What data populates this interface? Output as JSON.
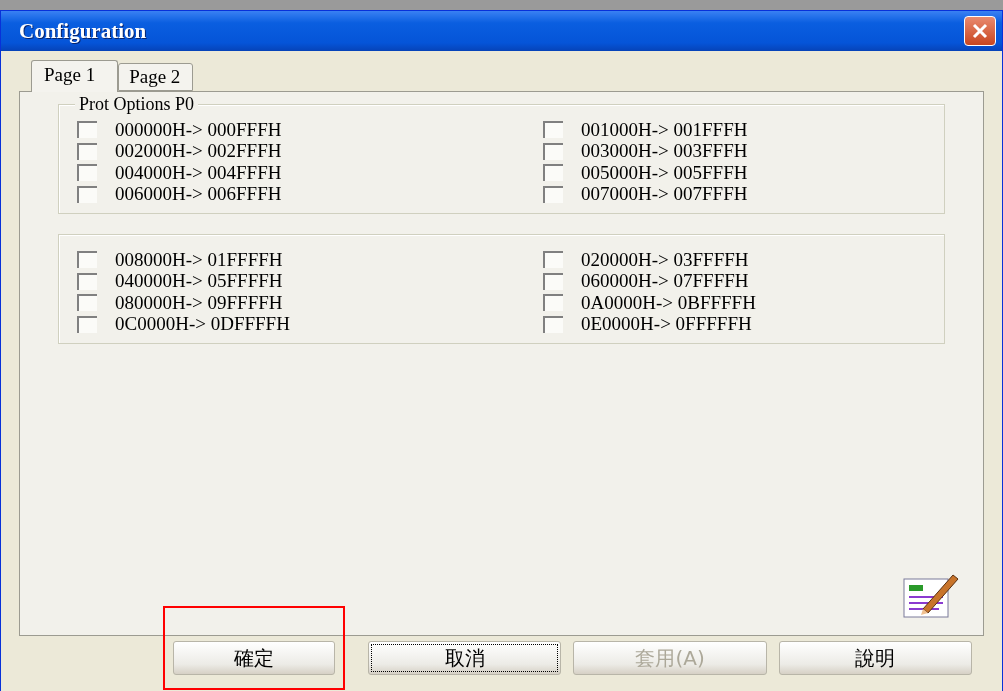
{
  "window": {
    "title": "Configuration"
  },
  "tabs": [
    {
      "label": "Page 1",
      "selected": true
    },
    {
      "label": "Page 2",
      "selected": false
    }
  ],
  "groups": [
    {
      "title": "Prot Options P0",
      "options": [
        {
          "label": "000000H-> 000FFFH",
          "checked": false
        },
        {
          "label": "001000H-> 001FFFH",
          "checked": false
        },
        {
          "label": "002000H-> 002FFFH",
          "checked": false
        },
        {
          "label": "003000H-> 003FFFH",
          "checked": false
        },
        {
          "label": "004000H-> 004FFFH",
          "checked": false
        },
        {
          "label": "005000H-> 005FFFH",
          "checked": false
        },
        {
          "label": "006000H-> 006FFFH",
          "checked": false
        },
        {
          "label": "007000H-> 007FFFH",
          "checked": false
        }
      ]
    },
    {
      "options": [
        {
          "label": "008000H-> 01FFFFH",
          "checked": false
        },
        {
          "label": "020000H-> 03FFFFH",
          "checked": false
        },
        {
          "label": "040000H-> 05FFFFH",
          "checked": false
        },
        {
          "label": "060000H-> 07FFFFH",
          "checked": false
        },
        {
          "label": "080000H-> 09FFFFH",
          "checked": false
        },
        {
          "label": "0A0000H-> 0BFFFFH",
          "checked": false
        },
        {
          "label": "0C0000H-> 0DFFFFH",
          "checked": false
        },
        {
          "label": "0E0000H-> 0FFFFFH",
          "checked": false
        }
      ]
    }
  ],
  "buttons": [
    {
      "label": "確定",
      "disabled": false,
      "focused": false,
      "highlighted": true
    },
    {
      "label": "取消",
      "disabled": false,
      "focused": true,
      "highlighted": false
    },
    {
      "label": "套用(A)",
      "disabled": true,
      "focused": false,
      "highlighted": false
    },
    {
      "label": "說明",
      "disabled": false,
      "focused": false,
      "highlighted": false
    }
  ]
}
